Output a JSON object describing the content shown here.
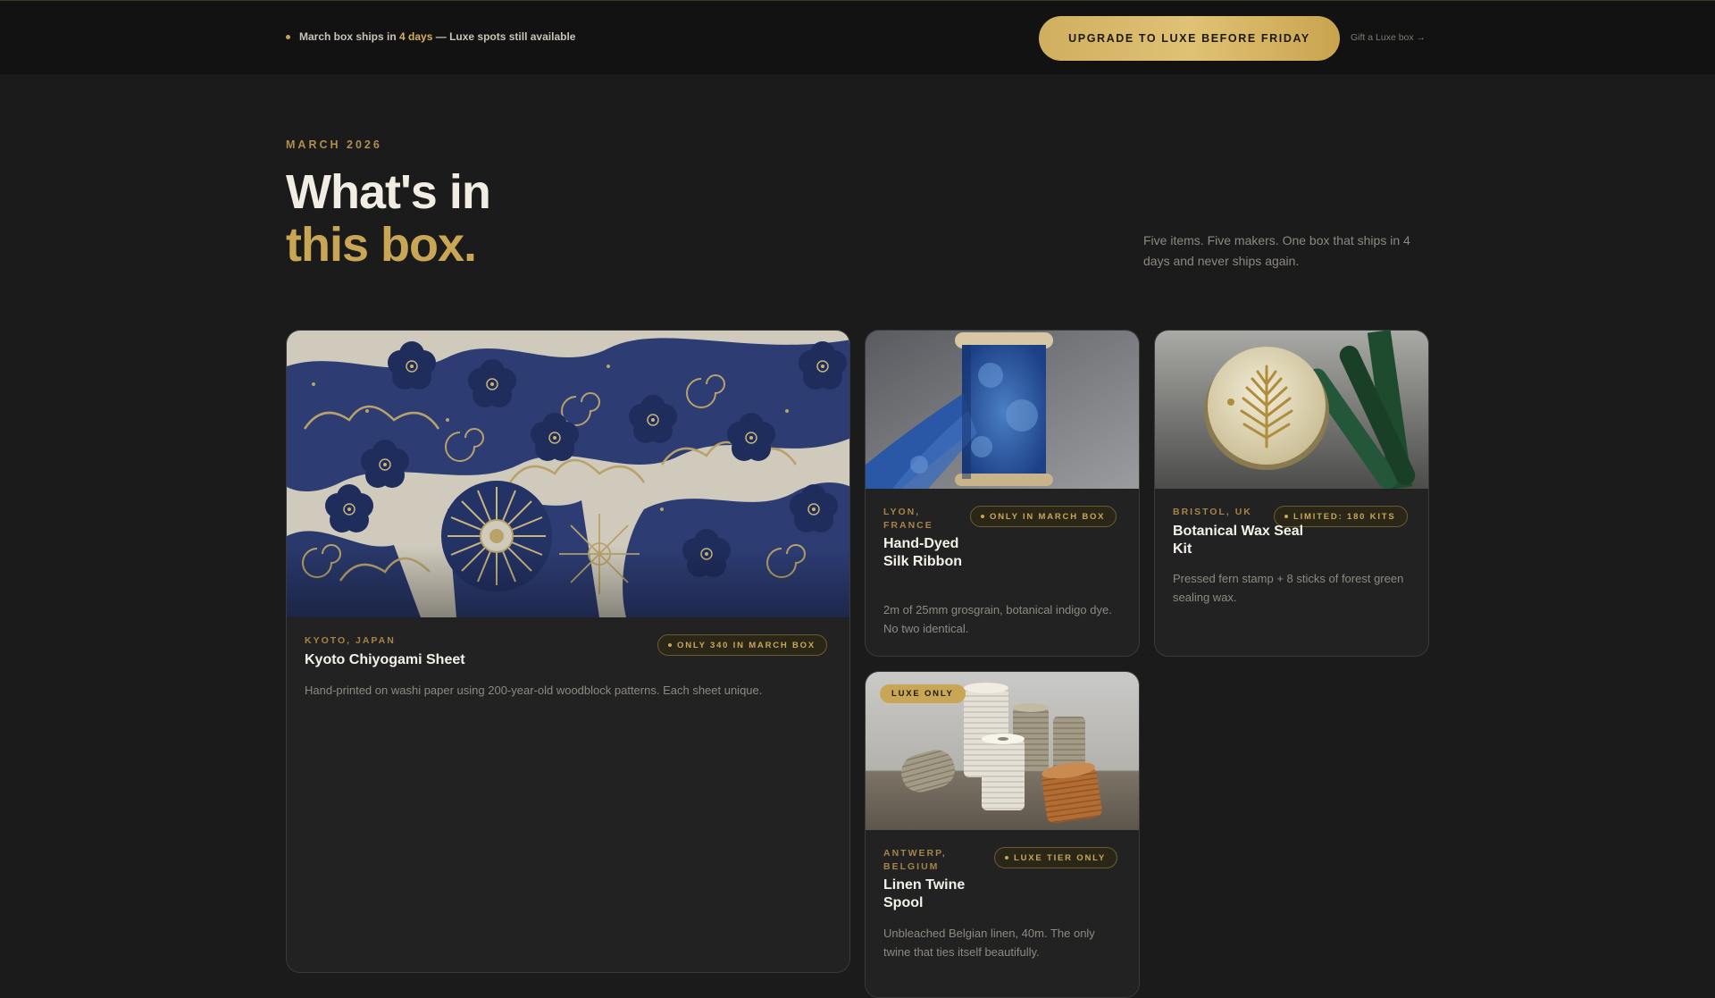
{
  "banner": {
    "text_before": "March box ships in",
    "days": "4 days",
    "text_after": "— Luxe spots still available",
    "cta_label": "UPGRADE TO LUXE BEFORE FRIDAY",
    "gift_link": "Gift a Luxe box →"
  },
  "hero": {
    "eyebrow": "MARCH 2026",
    "title_line1": "What's in",
    "title_line2": "this box.",
    "description": "Five items. Five makers. One box that ships in 4 days and never ships again."
  },
  "colors": {
    "accent_gold": "#c9a656",
    "background": "#1b1b1b",
    "card": "#222222"
  },
  "products": [
    {
      "origin": "KYOTO, JAPAN",
      "name": "Kyoto Chiyogami Sheet",
      "badge": "ONLY 340 IN MARCH BOX",
      "description": "Hand-printed on washi paper using 200-year-old woodblock patterns. Each sheet unique.",
      "image": "chiyogami-paper-image"
    },
    {
      "origin": "LYON, FRANCE",
      "name": "Hand-Dyed Silk Ribbon",
      "badge": "ONLY IN MARCH BOX",
      "description": "2m of 25mm grosgrain, botanical indigo dye. No two identical.",
      "image": "silk-ribbon-image"
    },
    {
      "origin": "BRISTOL, UK",
      "name": "Botanical Wax Seal Kit",
      "badge": "LIMITED: 180 KITS",
      "description": "Pressed fern stamp + 8 sticks of forest green sealing wax.",
      "image": "wax-seal-image"
    },
    {
      "origin": "ANTWERP, BELGIUM",
      "name": "Linen Twine Spool",
      "badge": "LUXE TIER ONLY",
      "tag": "LUXE ONLY",
      "description": "Unbleached Belgian linen, 40m. The only twine that ties itself beautifully.",
      "image": "linen-twine-image"
    }
  ]
}
